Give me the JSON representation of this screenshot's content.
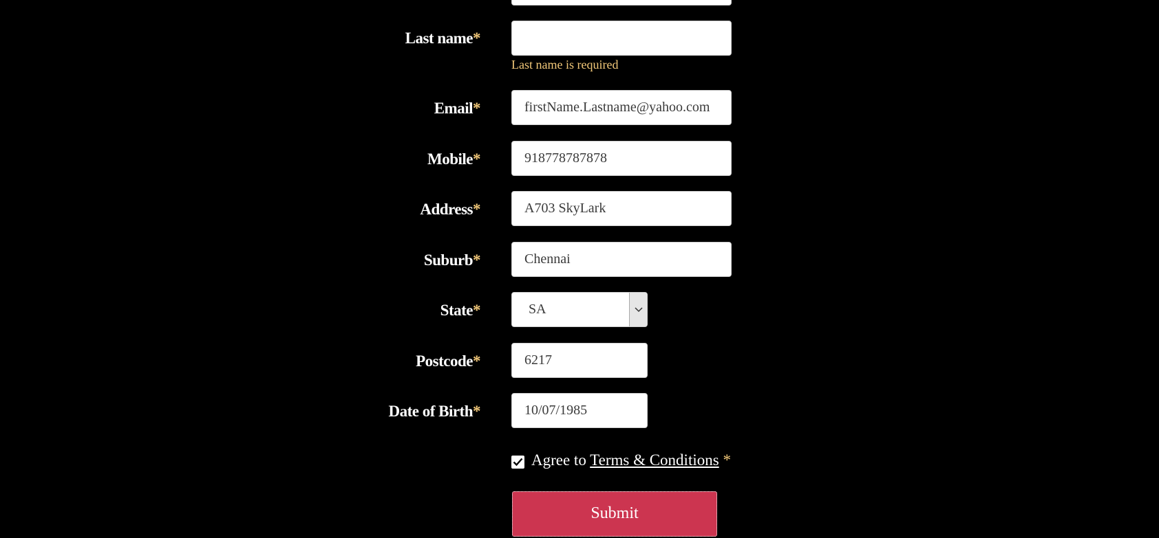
{
  "form": {
    "required_marker": "*",
    "last_name": {
      "label": "Last name",
      "value": "",
      "error": "Last name is required"
    },
    "email": {
      "label": "Email",
      "value": "firstName.Lastname@yahoo.com"
    },
    "mobile": {
      "label": "Mobile",
      "value": "918778787878"
    },
    "address": {
      "label": "Address",
      "value": "A703 SkyLark"
    },
    "suburb": {
      "label": "Suburb",
      "value": "Chennai"
    },
    "state": {
      "label": "State",
      "selected": "SA"
    },
    "postcode": {
      "label": "Postcode",
      "value": "6217"
    },
    "dob": {
      "label": "Date of Birth",
      "value": "10/07/1985"
    },
    "agree": {
      "checked": true,
      "prefix": "Agree to",
      "link": "Terms & Conditions"
    },
    "submit_label": "Submit"
  },
  "icons": {
    "select_arrow": "chevron-down-icon",
    "checkbox": "checkmark-icon"
  },
  "colors": {
    "background": "#000000",
    "accent_required": "#f2c879",
    "submit_bg": "#cc3550",
    "field_bg": "#ffffff"
  }
}
